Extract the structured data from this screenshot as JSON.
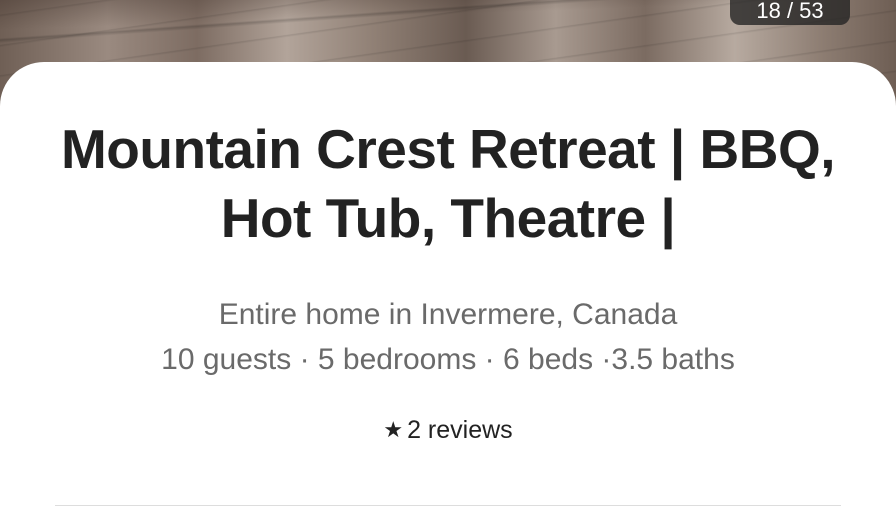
{
  "photo": {
    "counter_text": "18 / 53"
  },
  "listing": {
    "title": "Mountain Crest Retreat | BBQ, Hot Tub, Theatre |",
    "location": "Entire home in Invermere, Canada",
    "details": "10 guests · 5 bedrooms · 6 beds ·3.5 baths",
    "reviews_label": "2 reviews",
    "star_icon": "star-icon"
  },
  "colors": {
    "title": "#222222",
    "subtitle": "#6a6a6a",
    "divider": "#dddddd"
  }
}
